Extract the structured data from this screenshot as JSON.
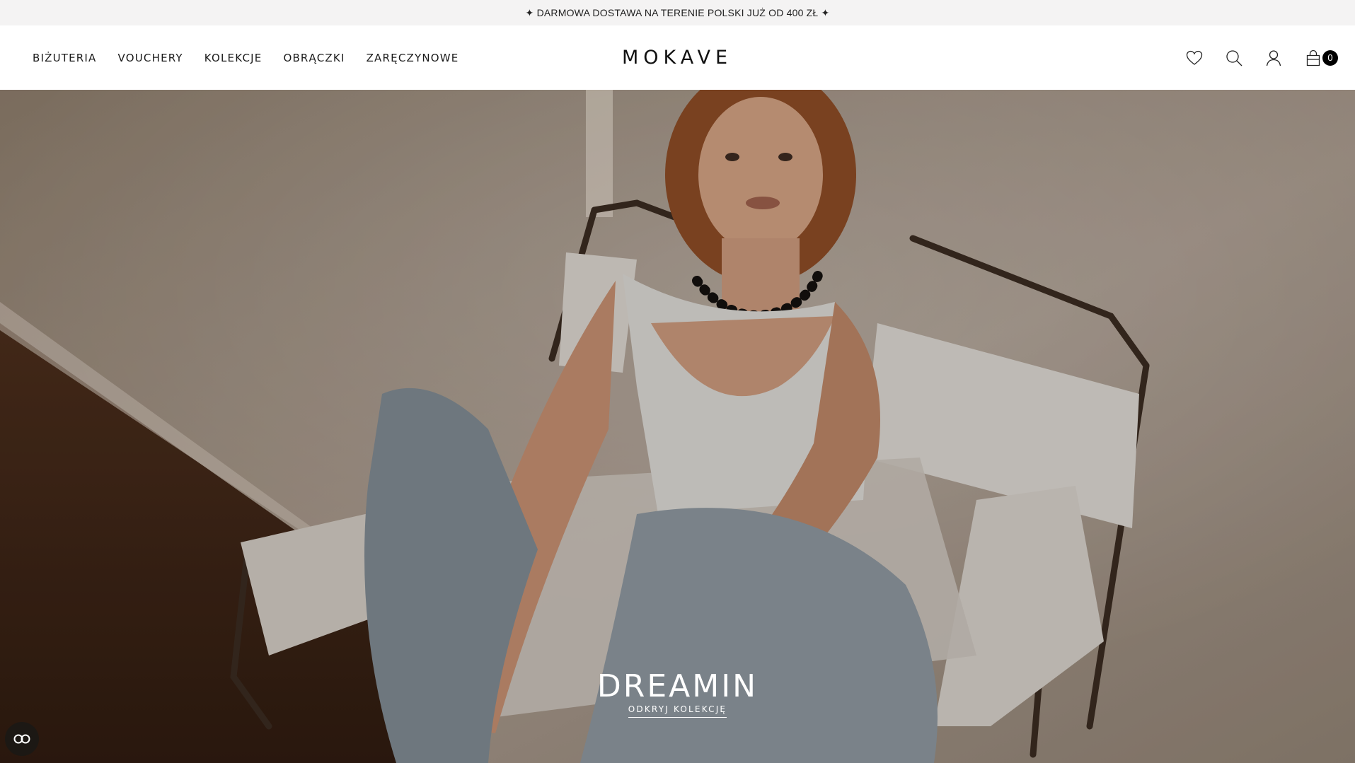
{
  "announcement": {
    "text": "✦ DARMOWA DOSTAWA NA TERENIE POLSKI JUŻ OD 400 ZŁ ✦"
  },
  "nav": {
    "items": [
      {
        "label": "BIŻUTERIA"
      },
      {
        "label": "VOUCHERY"
      },
      {
        "label": "KOLEKCJE"
      },
      {
        "label": "OBRĄCZKI"
      },
      {
        "label": "ZARĘCZYNOWE"
      }
    ]
  },
  "brand": {
    "logo": "MOKAVE"
  },
  "header_icons": {
    "wishlist": "heart-icon",
    "search": "search-icon",
    "account": "user-icon",
    "cart": "bag-icon",
    "cart_count": "0"
  },
  "hero": {
    "title": "DREAMIN",
    "cta": "ODKRYJ KOLEKCJĘ"
  },
  "accessibility": {
    "icon": "accessibility-icon"
  },
  "colors": {
    "announcement_bg": "#f4f3f3",
    "hero_text": "#ffffff",
    "badge_bg": "#000000"
  }
}
